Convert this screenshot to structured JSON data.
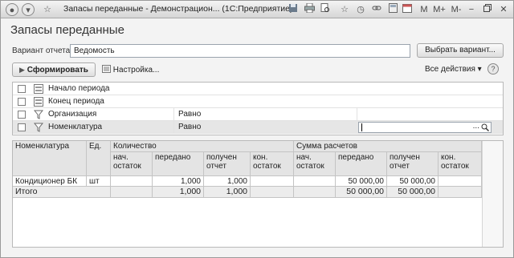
{
  "window": {
    "title": "Запасы переданные - Демонстрацион... (1С:Предприятие)",
    "right_buttons": [
      "M",
      "M+",
      "M-"
    ]
  },
  "form": {
    "title": "Запасы переданные",
    "variant_label": "Вариант отчета:",
    "variant_value": "Ведомость",
    "choose_variant": "Выбрать вариант...",
    "generate": "Сформировать",
    "settings": "Настройка...",
    "all_actions": "Все действия ▾",
    "help": "?"
  },
  "filters": [
    {
      "name": "Начало периода",
      "op": ""
    },
    {
      "name": "Конец периода",
      "op": ""
    },
    {
      "name": "Организация",
      "op": "Равно"
    },
    {
      "name": "Номенклатура",
      "op": "Равно"
    }
  ],
  "filter_value_dots": "...",
  "report": {
    "h1": {
      "nomenclature": "Номенклатура",
      "unit": "Ед.",
      "quantity": "Количество",
      "amount": "Сумма расчетов"
    },
    "h2": [
      "нач. остаток",
      "передано",
      "получен отчет",
      "кон. остаток",
      "нач. остаток",
      "передано",
      "получен отчет",
      "кон. остаток"
    ],
    "rows": [
      {
        "name": "Кондиционер БК",
        "unit": "шт",
        "values": [
          "",
          "1,000",
          "1,000",
          "",
          "",
          "50 000,00",
          "50 000,00",
          ""
        ]
      }
    ],
    "total": {
      "name": "Итого",
      "values": [
        "",
        "1,000",
        "1,000",
        "",
        "",
        "50 000,00",
        "50 000,00",
        ""
      ]
    }
  }
}
